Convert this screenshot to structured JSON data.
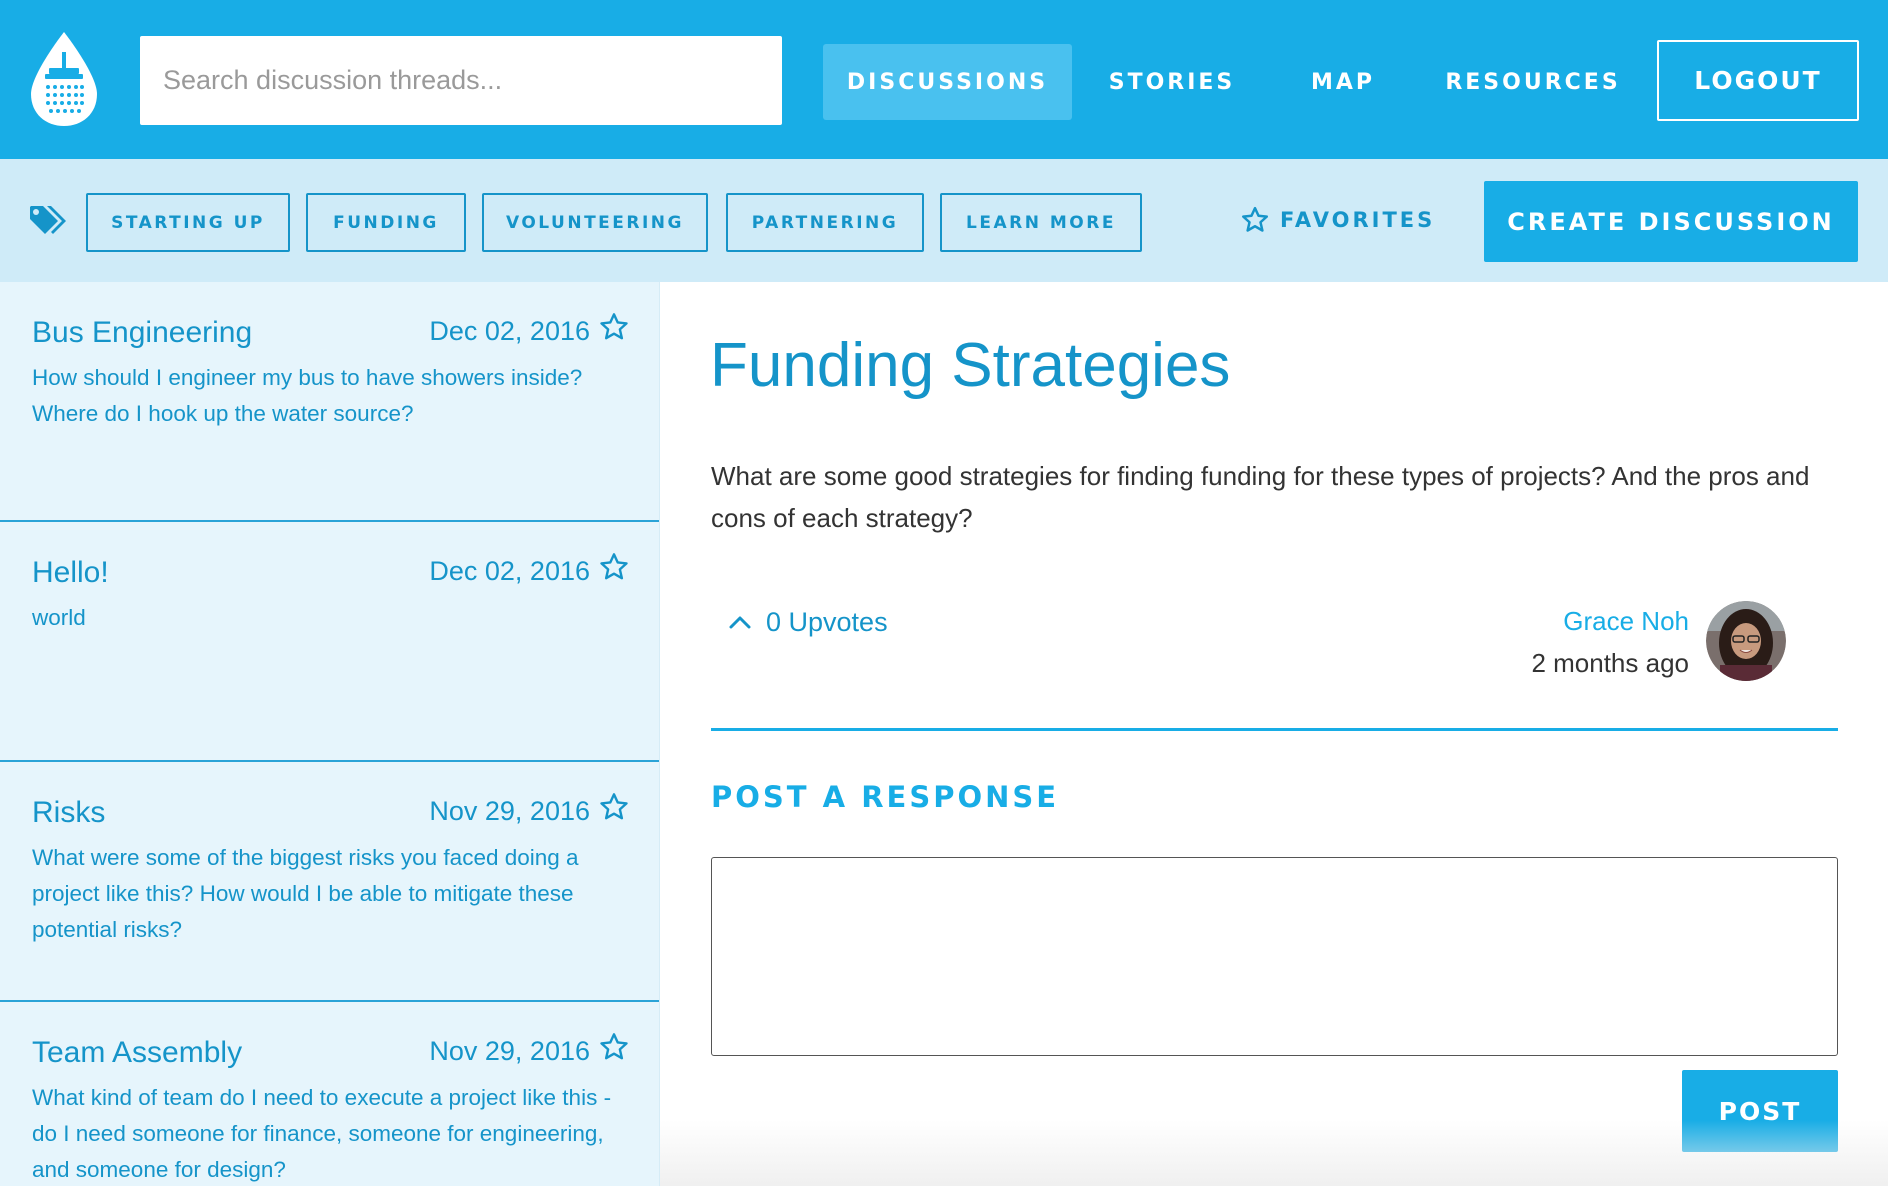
{
  "colors": {
    "accent": "#18ade6",
    "accent_dark": "#1594c9",
    "panel": "#e6f5fc",
    "tagbar": "#cfebf8"
  },
  "header": {
    "logo_icon": "water-drop-shower-icon",
    "search_placeholder": "Search discussion threads...",
    "nav": [
      {
        "label": "DISCUSSIONS",
        "active": true
      },
      {
        "label": "STORIES",
        "active": false
      },
      {
        "label": "MAP",
        "active": false
      },
      {
        "label": "RESOURCES",
        "active": false
      }
    ],
    "logout_label": "LOGOUT"
  },
  "tagbar": {
    "tag_icon": "tags-icon",
    "tags": [
      "STARTING UP",
      "FUNDING",
      "VOLUNTEERING",
      "PARTNERING",
      "LEARN MORE"
    ],
    "favorites_label": "FAVORITES",
    "create_label": "CREATE DISCUSSION"
  },
  "threads": [
    {
      "title": "Bus Engineering",
      "date": "Dec 02, 2016",
      "body": "How should I engineer my bus to have showers inside? Where do I hook up the water source?"
    },
    {
      "title": "Hello!",
      "date": "Dec 02, 2016",
      "body": "world"
    },
    {
      "title": "Risks",
      "date": "Nov 29, 2016",
      "body": "What were some of the biggest risks you faced doing a project like this? How would I be able to mitigate these potential risks?"
    },
    {
      "title": "Team Assembly",
      "date": "Nov 29, 2016",
      "body": "What kind of team do I need to execute a project like this - do I need someone for finance, someone for engineering, and someone for design?"
    }
  ],
  "discussion": {
    "title": "Funding Strategies",
    "body": "What are some good strategies for finding funding for these types of projects? And the pros and cons of each strategy?",
    "upvotes_label": "0 Upvotes",
    "author": "Grace Noh",
    "time_ago": "2 months ago"
  },
  "response": {
    "heading": "POST A RESPONSE",
    "textarea_value": "",
    "post_label": "POST"
  }
}
